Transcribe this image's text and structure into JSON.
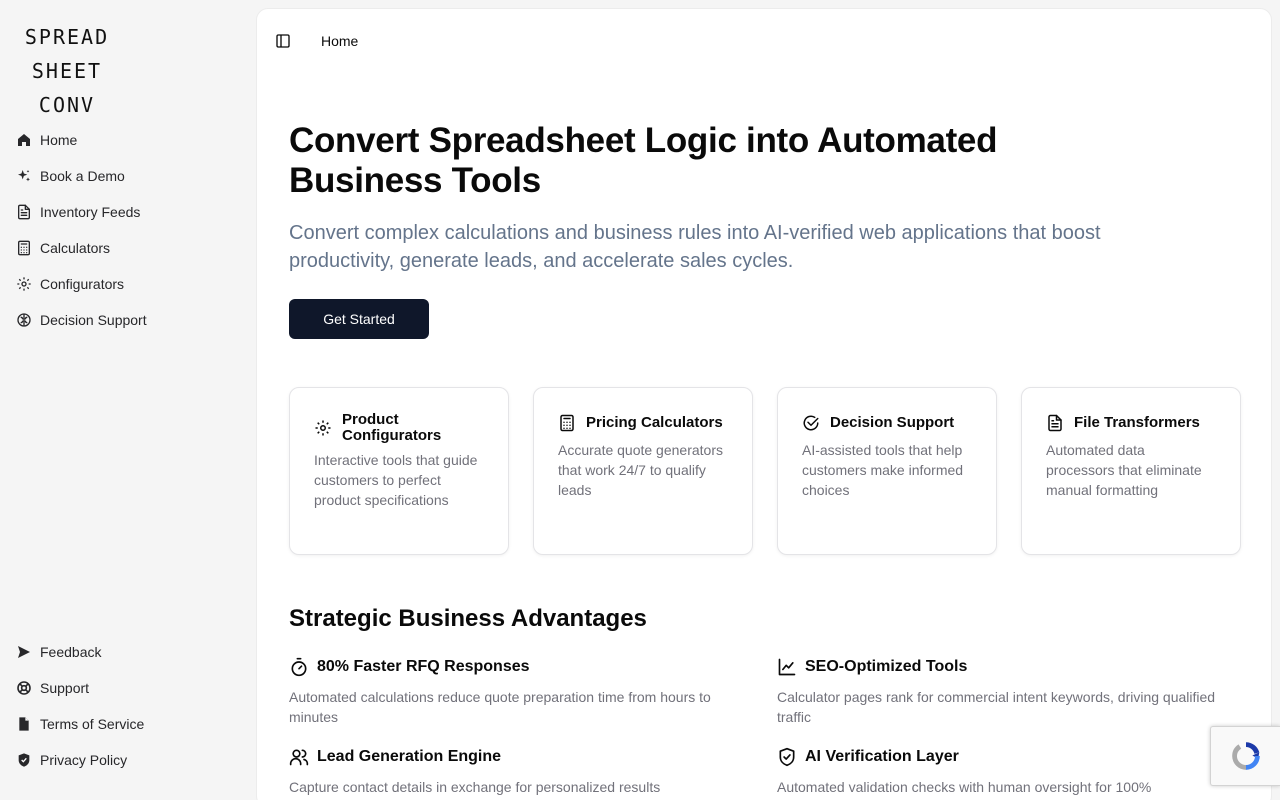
{
  "logo": {
    "line1": "SPREAD",
    "line2": "SHEET",
    "line3": "CONV"
  },
  "sidebar": {
    "items": [
      {
        "label": "Home",
        "icon": "home-icon"
      },
      {
        "label": "Book a Demo",
        "icon": "sparkles-icon"
      },
      {
        "label": "Inventory Feeds",
        "icon": "file-text-icon"
      },
      {
        "label": "Calculators",
        "icon": "calculator-icon"
      },
      {
        "label": "Configurators",
        "icon": "gear-icon"
      },
      {
        "label": "Decision Support",
        "icon": "brain-icon"
      }
    ],
    "footer_items": [
      {
        "label": "Feedback",
        "icon": "send-icon"
      },
      {
        "label": "Support",
        "icon": "lifebuoy-icon"
      },
      {
        "label": "Terms of Service",
        "icon": "file-icon"
      },
      {
        "label": "Privacy Policy",
        "icon": "shield-check-icon"
      }
    ]
  },
  "header": {
    "breadcrumb": "Home",
    "toggle_icon": "sidebar-toggle-icon"
  },
  "hero": {
    "title": "Convert Spreadsheet Logic into Automated Business Tools",
    "subtitle": "Convert complex calculations and business rules into AI-verified web applications that boost productivity, generate leads, and accelerate sales cycles.",
    "cta": "Get Started"
  },
  "features": [
    {
      "title": "Product Configurators",
      "desc": "Interactive tools that guide customers to perfect product specifications",
      "icon": "gear-icon"
    },
    {
      "title": "Pricing Calculators",
      "desc": "Accurate quote generators that work 24/7 to qualify leads",
      "icon": "calculator-icon"
    },
    {
      "title": "Decision Support",
      "desc": "AI-assisted tools that help customers make informed choices",
      "icon": "circle-check-icon"
    },
    {
      "title": "File Transformers",
      "desc": "Automated data processors that eliminate manual formatting",
      "icon": "file-text-icon"
    }
  ],
  "advantages": {
    "title": "Strategic Business Advantages",
    "items": [
      {
        "title": "80% Faster RFQ Responses",
        "desc": "Automated calculations reduce quote preparation time from hours to minutes",
        "icon": "timer-icon"
      },
      {
        "title": "SEO-Optimized Tools",
        "desc": "Calculator pages rank for commercial intent keywords, driving qualified traffic",
        "icon": "line-chart-icon"
      },
      {
        "title": "Lead Generation Engine",
        "desc": "Capture contact details in exchange for personalized results",
        "icon": "users-icon"
      },
      {
        "title": "AI Verification Layer",
        "desc": "Automated validation checks with human oversight for 100%",
        "icon": "shield-check-icon"
      }
    ]
  },
  "colors": {
    "primary": "#0f172a",
    "muted_text": "#71717a",
    "subtitle_text": "#64748b",
    "sidebar_bg": "#f5f5f5"
  }
}
